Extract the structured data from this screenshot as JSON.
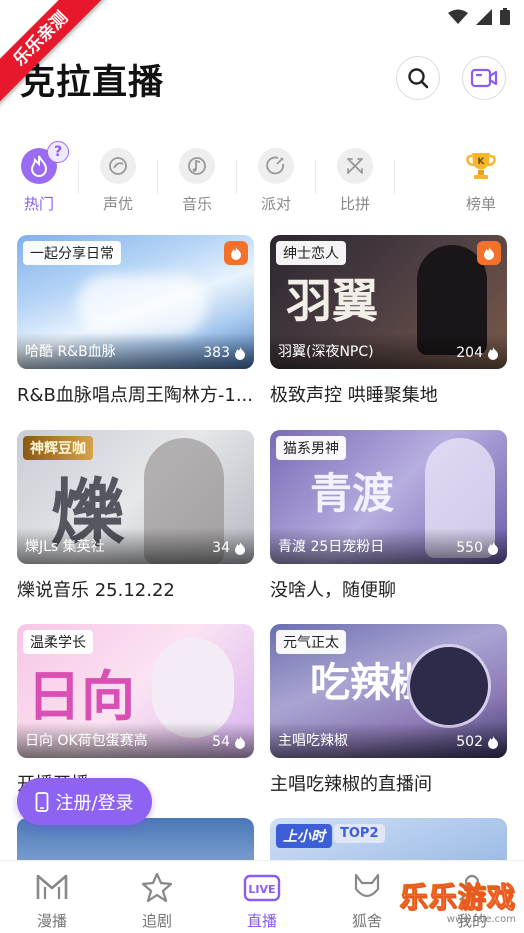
{
  "ribbon": {
    "text": "乐乐亲测"
  },
  "app": {
    "title": "克拉直播"
  },
  "header": {
    "search_icon": "search-icon",
    "video_icon": "video-camera-icon"
  },
  "categories": [
    {
      "label": "热门",
      "icon": "fire-icon",
      "active": true
    },
    {
      "label": "声优",
      "icon": "microphone-icon"
    },
    {
      "label": "音乐",
      "icon": "music-icon"
    },
    {
      "label": "派对",
      "icon": "party-icon"
    },
    {
      "label": "比拼",
      "icon": "battle-icon"
    },
    {
      "label": "榜单",
      "icon": "trophy-icon"
    }
  ],
  "help_badge": "?",
  "cards": [
    {
      "tag": "一起分享日常",
      "anchor": "哈酷 R&B血脉",
      "viewers": "383",
      "title": "R&B血脉唱点周王陶林方-1..."
    },
    {
      "tag": "绅士恋人",
      "anchor": "羽翼(深夜NPC)",
      "viewers": "204",
      "title": "极致声控 哄睡聚集地",
      "art": "羽翼"
    },
    {
      "tag": "神辉豆咖",
      "anchor": "爍JLs 集英社",
      "viewers": "34",
      "title": "爍说音乐 25.12.22",
      "art": "爍"
    },
    {
      "tag": "猫系男神",
      "anchor": "青渡 25日宠粉日",
      "viewers": "550",
      "title": "没啥人，随便聊",
      "art": "青渡"
    },
    {
      "tag": "温柔学长",
      "anchor": "日向 OK荷包蛋赛高",
      "viewers": "54",
      "title": "开播开播",
      "art": "日向"
    },
    {
      "tag": "元气正太",
      "anchor": "主唱吃辣椒",
      "viewers": "502",
      "title": "主唱吃辣椒的直播间",
      "art": "吃辣椒"
    },
    {
      "tag": "",
      "anchor": "",
      "viewers": "",
      "title": ""
    },
    {
      "tag": "上小时",
      "tag2": "TOP2",
      "anchor": "",
      "viewers": "",
      "title": ""
    }
  ],
  "login": {
    "label": "注册/登录"
  },
  "bottom_nav": [
    {
      "label": "漫播",
      "icon": "manbo-icon"
    },
    {
      "label": "追剧",
      "icon": "star-icon"
    },
    {
      "label": "直播",
      "icon": "live-icon",
      "active": true
    },
    {
      "label": "狐舍",
      "icon": "fox-icon"
    },
    {
      "label": "我的",
      "icon": "profile-icon"
    }
  ],
  "watermark": {
    "text": "乐乐游戏",
    "url": "www.lele.com"
  },
  "colors": {
    "accent": "#8a5cf0",
    "ribbon": "#e8182c",
    "fire": "#f2712b"
  }
}
